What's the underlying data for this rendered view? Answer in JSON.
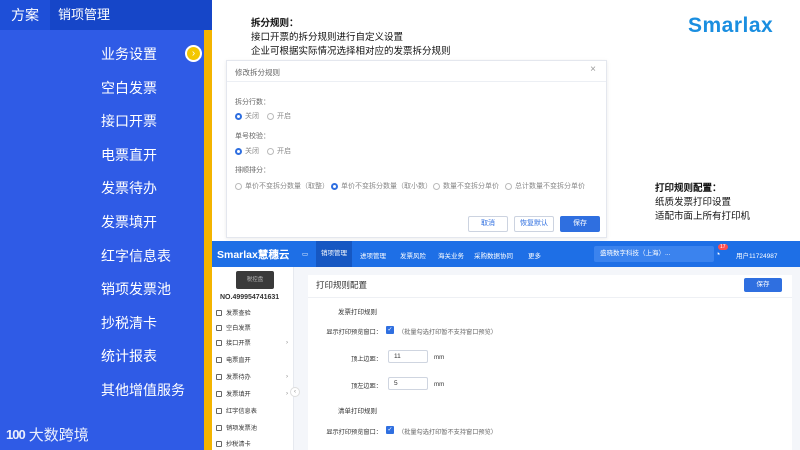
{
  "left_panel": {
    "tab_fangan": "方案",
    "tab_sales": "销项管理",
    "nav": [
      "业务设置",
      "空白发票",
      "接口开票",
      "电票直开",
      "发票待办",
      "发票填开",
      "红字信息表",
      "销项发票池",
      "抄税清卡",
      "统计报表",
      "其他增值服务"
    ],
    "dot_icon": "arrow-right-circle-icon",
    "logo_mark": "100",
    "logo_text": "大数跨境"
  },
  "top_note": {
    "title": "拆分规则：",
    "lines": [
      "接口开票的拆分规则进行自定义设置",
      "企业可根据实际情况选择相对应的发票拆分规则"
    ]
  },
  "brand": "Smarlax",
  "dialog": {
    "title": "修改拆分规则",
    "close": "×",
    "split_label": "拆分行数：",
    "off": "关闭",
    "on": "开启",
    "unit_check_label": "单号校验：",
    "sort_label": "排顺排分：",
    "sort_options": [
      "单价不变拆分数量（取整）",
      "单价不变拆分数量（取小数）",
      "数量不变拆分单价",
      "总计数量不变拆分单价"
    ],
    "cancel": "取消",
    "reset": "恢复默认",
    "save": "保存"
  },
  "side_note": {
    "title": "打印规则配置：",
    "lines": [
      "纸质发票打印设置",
      "适配市面上所有打印机"
    ]
  },
  "app": {
    "logo": "Smarlax慧穗云",
    "tabs": [
      "销项管理",
      "进项管理",
      "发票风险",
      "海关业务",
      "采购数据协同",
      "更多"
    ],
    "company": "盛晓数字科技（上海）...",
    "badge": "17",
    "user": "用户11724987",
    "device_label": "税控盘",
    "device_no": "NO.499954741631",
    "side_items": [
      "发票查验",
      "空白发票",
      "接口开票",
      "电票直开",
      "发票待办",
      "发票填开",
      "红字信息表",
      "销项发票池",
      "抄税清卡"
    ],
    "content_title": "打印规则配置",
    "save": "保存",
    "section1": "发票打印规则",
    "show_preview_label": "显示打印预览窗口：",
    "show_preview_hint": "（批量勾选打印暂不支持窗口预览）",
    "top_margin_label": "顶上边距：",
    "top_margin_value": "11",
    "left_margin_label": "顶左边距：",
    "left_margin_value": "5",
    "unit": "mm",
    "section2": "清单打印规则",
    "show_preview_label2": "显示打印预览窗口：",
    "show_preview_hint2": "（批量勾选打印暂不支持窗口预览）"
  }
}
